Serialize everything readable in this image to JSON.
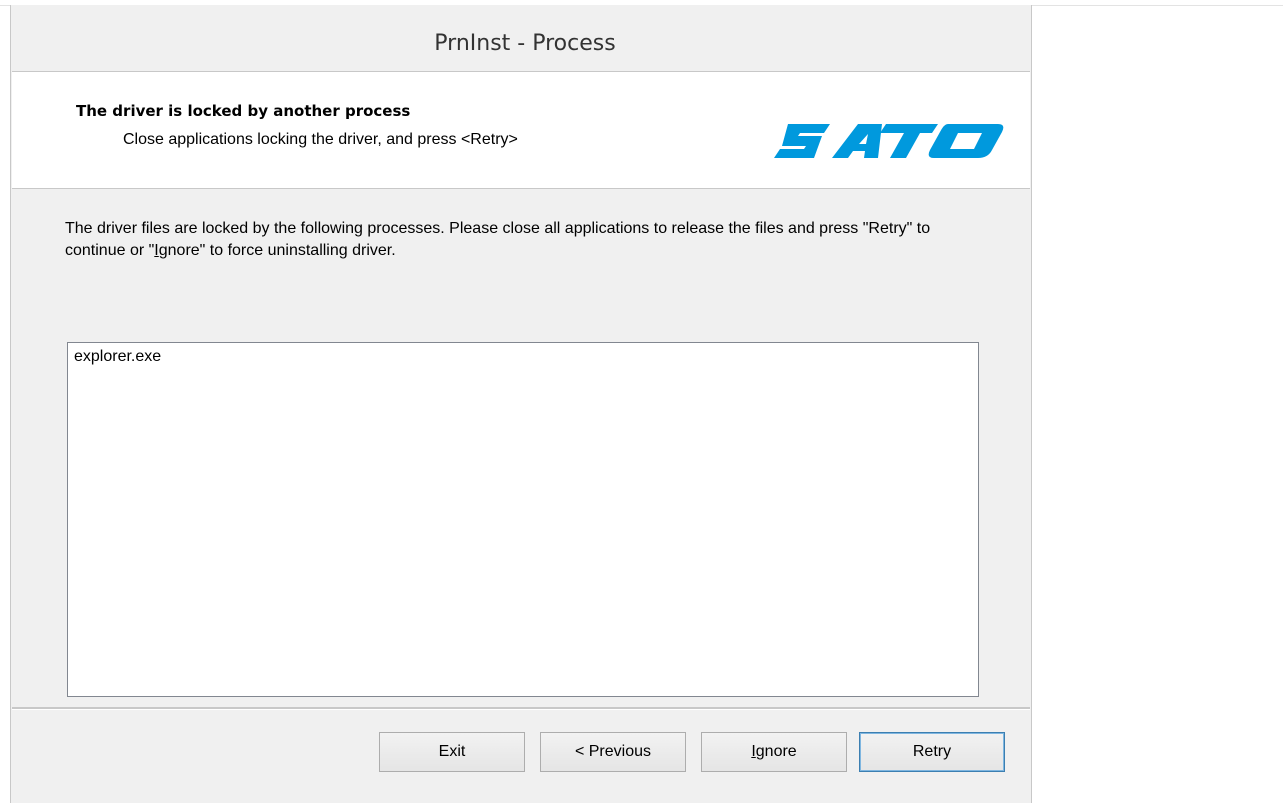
{
  "window": {
    "title": "PrnInst - Process"
  },
  "header": {
    "title": "The driver is locked by another process",
    "subtitle": "Close applications locking the driver, and press <Retry>",
    "logo_text": "SATO",
    "logo_color": "#0099dd"
  },
  "body": {
    "message_part1": "The driver files are locked by the following processes. Please close all applications to release the files and press \"Retry\" to continue or \"",
    "message_ignore_first": "I",
    "message_part2": "gnore\" to force uninstalling driver.",
    "processes": [
      "explorer.exe"
    ]
  },
  "buttons": {
    "exit": "Exit",
    "previous": "< Previous",
    "ignore_first": "I",
    "ignore_rest": "gnore",
    "retry": "Retry"
  }
}
